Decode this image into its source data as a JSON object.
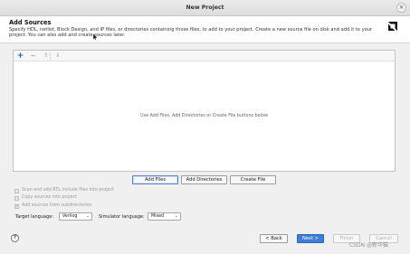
{
  "window": {
    "title": "New Project",
    "close_glyph": "×",
    "close_icon": "close-icon"
  },
  "header": {
    "title": "Add Sources",
    "description": "Specify HDL, netlist, Block Design, and IP files, or directories containing those files, to add to your project. Create a new source file on disk and add it to your project. You can also add and create sources later.",
    "logo_icon": "amd-logo-icon"
  },
  "toolbar": {
    "add_glyph": "+",
    "add_icon": "plus-icon",
    "remove_glyph": "−",
    "remove_icon": "minus-icon",
    "up_glyph": "⇑",
    "up_icon": "move-up-icon",
    "down_glyph": "⇓",
    "down_icon": "move-down-icon"
  },
  "sources": {
    "empty_hint": "Use Add Files, Add Directories or Create File buttons below"
  },
  "actions": {
    "add_files": "Add Files",
    "add_directories": "Add Directories",
    "create_file": "Create File"
  },
  "options": {
    "scan_rtl": {
      "label": "Scan and add RTL include files into project",
      "checked": false,
      "enabled": false
    },
    "copy_sources": {
      "label": "Copy sources into project",
      "checked": false,
      "enabled": false
    },
    "add_subdirs": {
      "label": "Add sources from subdirectories",
      "checked": true,
      "enabled": false,
      "check_glyph": "✓"
    }
  },
  "languages": {
    "target_label": "Target language:",
    "target_value": "Verilog",
    "simulator_label": "Simulator language:",
    "simulator_value": "Mixed",
    "dropdown_glyph": "⌄"
  },
  "footer": {
    "help_glyph": "?",
    "back": "< Back",
    "next": "Next >",
    "finish": "Finish",
    "cancel": "Cancel"
  },
  "watermark": "CSDN @新华猫",
  "colors": {
    "primary_button": "#3d7ed8",
    "selected_button_border": "#5a86c8"
  }
}
